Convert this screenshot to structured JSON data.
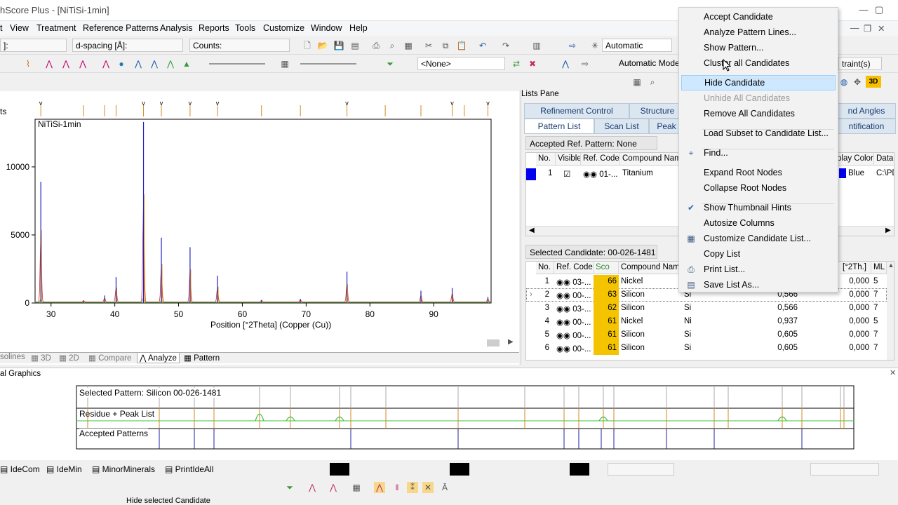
{
  "title": "hScore Plus - [NiTiSi-1min]",
  "menu": [
    "t",
    "View",
    "Treatment",
    "Reference Patterns",
    "Analysis",
    "Reports",
    "Tools",
    "Customize",
    "Window",
    "Help"
  ],
  "toolbar": {
    "field1": "]:",
    "dspacing": "d-spacing [Å]:",
    "counts": "Counts:",
    "mode": "Automatic",
    "none_select": "<None>",
    "auto_mode": "Automatic Mode",
    "constraints": "traint(s)",
    "view3d": "3D"
  },
  "chart": {
    "title": "NiTiSi-1min",
    "xlabel": "Position [°2Theta] (Copper (Cu))",
    "ylabel_partial": "ts",
    "xticks": [
      "30",
      "40",
      "50",
      "60",
      "70",
      "80",
      "90"
    ],
    "yticks": [
      "10000",
      "5000",
      "0"
    ]
  },
  "chart_data": {
    "type": "line",
    "title": "NiTiSi-1min",
    "xlabel": "Position [°2Theta] (Copper (Cu))",
    "ylabel": "",
    "xlim": [
      27.5,
      99
    ],
    "ylim": [
      0,
      13500
    ],
    "grid": false,
    "series": [
      {
        "name": "",
        "x": [
          28.4,
          35.1,
          38.4,
          40.2,
          44.5,
          47.3,
          51.8,
          56.1,
          63.0,
          69.1,
          76.4,
          88.0,
          92.9,
          98.5
        ],
        "y": [
          8900,
          180,
          550,
          1900,
          13300,
          4800,
          4100,
          2000,
          220,
          300,
          2300,
          900,
          1100,
          450
        ]
      }
    ]
  },
  "left_tabs": [
    "solines",
    "3D",
    "2D",
    "Compare",
    "Analyze",
    "Pattern"
  ],
  "lists_pane": {
    "title": "Lists Pane",
    "tabs_row1": [
      "Refinement Control",
      "Structure",
      "nd Angles"
    ],
    "tabs_row2": [
      "Pattern List",
      "Scan List",
      "Peak",
      "ntification"
    ],
    "accepted_label": "Accepted Ref. Pattern: None",
    "accepted_headers": [
      "No.",
      "Visible",
      "Ref. Code",
      "Compound Name",
      "play Color",
      "Datal"
    ],
    "accepted_rows": [
      {
        "no": "1",
        "visible": "☑",
        "code": "01-...",
        "name": "Titanium",
        "color": "Blue",
        "data": "C:\\PD"
      }
    ],
    "selected_label": "Selected Candidate: 00-026-1481",
    "cand_headers": [
      "No.",
      "Ref. Code",
      "Sco",
      "Compound Name",
      "",
      "",
      "[°2Th.]",
      "ML"
    ],
    "cand_rows": [
      {
        "no": "1",
        "code": "03-...",
        "score": "66",
        "name": "Nickel",
        "formula": "",
        "val": "",
        "shift": "0,000",
        "ml": "5"
      },
      {
        "no": "2",
        "code": "00-...",
        "score": "63",
        "name": "Silicon",
        "formula": "Si",
        "val": "0,566",
        "shift": "0,000",
        "ml": "7"
      },
      {
        "no": "3",
        "code": "03-...",
        "score": "62",
        "name": "Silicon",
        "formula": "Si",
        "val": "0,566",
        "shift": "0,000",
        "ml": "7"
      },
      {
        "no": "4",
        "code": "00-...",
        "score": "61",
        "name": "Nickel",
        "formula": "Ni",
        "val": "0,937",
        "shift": "0,000",
        "ml": "5"
      },
      {
        "no": "5",
        "code": "00-...",
        "score": "61",
        "name": "Silicon",
        "formula": "Si",
        "val": "0,605",
        "shift": "0,000",
        "ml": "7"
      },
      {
        "no": "6",
        "code": "00-...",
        "score": "61",
        "name": "Silicon",
        "formula": "Si",
        "val": "0,605",
        "shift": "0,000",
        "ml": "7"
      }
    ]
  },
  "bottom_pane": {
    "title": "al Graphics",
    "selected_pattern": "Selected Pattern: Silicon  00-026-1481",
    "residue": "Residue + Peak List",
    "accepted": "Accepted Patterns"
  },
  "bottom_tools": [
    "IdeCom",
    "IdeMin",
    "MinorMinerals",
    "PrintIdeAll"
  ],
  "status": "Hide selected Candidate",
  "context_menu": [
    {
      "label": "Accept Candidate",
      "state": "normal"
    },
    {
      "label": "Analyze Pattern Lines...",
      "state": "normal"
    },
    {
      "label": "Show Pattern...",
      "state": "normal"
    },
    {
      "label": "Cluster all Candidates",
      "state": "normal"
    },
    {
      "label": "Hide Candidate",
      "state": "highlight"
    },
    {
      "label": "Unhide All Candidates",
      "state": "disabled"
    },
    {
      "label": "Remove All Candidates",
      "state": "normal"
    },
    {
      "label": "Load Subset to Candidate List...",
      "state": "normal"
    },
    {
      "label": "Find...",
      "state": "normal",
      "icon": "binoculars-icon"
    },
    {
      "label": "Expand Root Nodes",
      "state": "normal"
    },
    {
      "label": "Collapse Root Nodes",
      "state": "normal"
    },
    {
      "label": "Show Thumbnail Hints",
      "state": "checked"
    },
    {
      "label": "Autosize Columns",
      "state": "normal"
    },
    {
      "label": "Customize Candidate List...",
      "state": "normal",
      "icon": "customize-icon"
    },
    {
      "label": "Copy List",
      "state": "normal"
    },
    {
      "label": "Print List...",
      "state": "normal",
      "icon": "printer-icon"
    },
    {
      "label": "Save List As...",
      "state": "normal",
      "icon": "save-list-icon"
    }
  ]
}
